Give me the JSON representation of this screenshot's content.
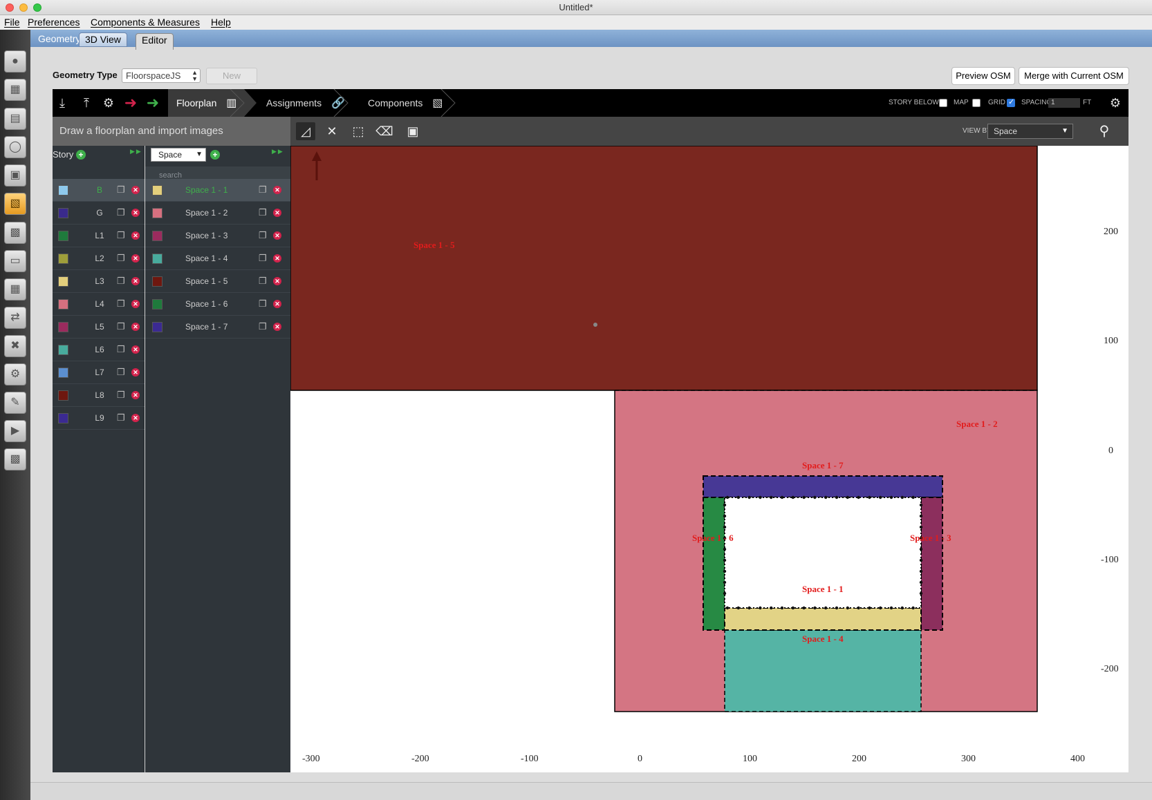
{
  "window": {
    "title": "Untitled*"
  },
  "menu": [
    "File",
    "Preferences",
    "Components & Measures",
    "Help"
  ],
  "tabs": {
    "geometry": "Geometry",
    "view3d": "3D View",
    "editor": "Editor"
  },
  "geometry_type": {
    "label": "Geometry Type",
    "value": "FloorspaceJS",
    "new_button": "New"
  },
  "actions": {
    "preview": "Preview OSM",
    "merge": "Merge with Current OSM"
  },
  "navigation": {
    "floorplan": "Floorplan",
    "assignments": "Assignments",
    "components": "Components"
  },
  "options": {
    "story_below": "STORY BELOW",
    "story_below_checked": false,
    "map": "MAP",
    "map_checked": false,
    "grid": "GRID",
    "grid_checked": true,
    "spacing": "SPACING",
    "spacing_value": "1",
    "spacing_unit": "FT"
  },
  "tools": {
    "subtitle": "Draw a floorplan and import images",
    "view_by_label": "VIEW BY",
    "view_by_value": "Space"
  },
  "story_panel": {
    "title": "Story",
    "stories": [
      {
        "name": "B",
        "color": "#8ec9ec",
        "selected": true
      },
      {
        "name": "G",
        "color": "#3a2a8c"
      },
      {
        "name": "L1",
        "color": "#1f7a3c"
      },
      {
        "name": "L2",
        "color": "#9e9e3a"
      },
      {
        "name": "L3",
        "color": "#e3cf7c"
      },
      {
        "name": "L4",
        "color": "#d6707f"
      },
      {
        "name": "L5",
        "color": "#9b2b5e"
      },
      {
        "name": "L6",
        "color": "#48ab9d"
      },
      {
        "name": "L7",
        "color": "#5b8fd0"
      },
      {
        "name": "L8",
        "color": "#6e170f"
      },
      {
        "name": "L9",
        "color": "#3b2a92"
      }
    ]
  },
  "space_panel": {
    "type": "Space",
    "search_placeholder": "search",
    "spaces": [
      {
        "name": "Space 1 - 1",
        "color": "#e3cf7c",
        "selected": true
      },
      {
        "name": "Space 1 - 2",
        "color": "#d6707f"
      },
      {
        "name": "Space 1 - 3",
        "color": "#9b2b5e"
      },
      {
        "name": "Space 1 - 4",
        "color": "#48ab9d"
      },
      {
        "name": "Space 1 - 5",
        "color": "#6e170f"
      },
      {
        "name": "Space 1 - 6",
        "color": "#1f7a3c"
      },
      {
        "name": "Space 1 - 7",
        "color": "#3b2a92"
      }
    ]
  },
  "canvas": {
    "x_ticks": [
      "-300",
      "-200",
      "-100",
      "0",
      "100",
      "200",
      "300",
      "400"
    ],
    "y_ticks": [
      "200",
      "100",
      "0",
      "-100",
      "-200"
    ],
    "labels": {
      "s5": "Space 1 - 5",
      "s2": "Space 1 - 2",
      "s7": "Space 1 - 7",
      "s6": "Space 1 - 6",
      "s3": "Space 1 - 3",
      "s1": "Space 1 - 1",
      "s4": "Space 1 - 4"
    },
    "colors": {
      "s5": "#7a271f",
      "s2": "#d47583",
      "s7": "#473895",
      "s6": "#278a44",
      "s3": "#8c2f5d",
      "s1": "#e2d386",
      "s4": "#55b4a5"
    }
  }
}
